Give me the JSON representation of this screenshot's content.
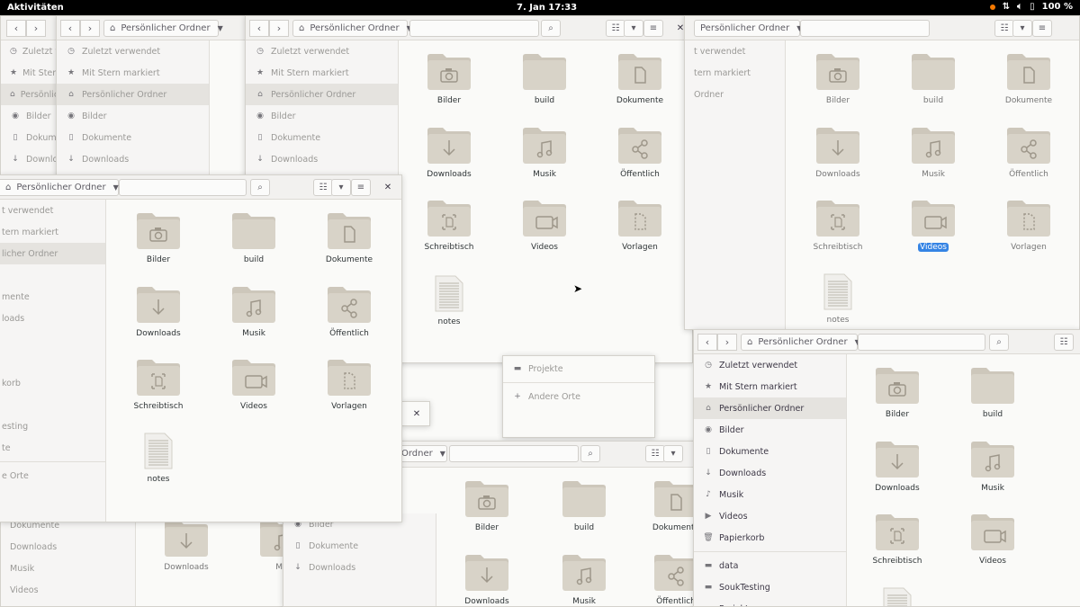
{
  "topbar": {
    "activities": "Aktivitäten",
    "clock": "7. Jan  17:33",
    "battery": "100 %"
  },
  "breadcrumb": "Persönlicher Ordner",
  "sidebar": {
    "recent": "Zuletzt verwendet",
    "starred": "Mit Stern markiert",
    "home": "Persönlicher Ordner",
    "pictures": "Bilder",
    "documents": "Dokumente",
    "downloads": "Downloads",
    "music": "Musik",
    "videos": "Videos",
    "trash": "Papierkorb",
    "data": "data",
    "souktesting": "SoukTesting",
    "projekte": "Projekte",
    "other": "Andere Orte"
  },
  "files": {
    "bilder": "Bilder",
    "build": "build",
    "dokumente": "Dokumente",
    "downloads": "Downloads",
    "musik": "Musik",
    "oeffentlich": "Öffentlich",
    "schreibtisch": "Schreibtisch",
    "videos": "Videos",
    "vorlagen": "Vorlagen",
    "notes": "notes"
  },
  "partial": {
    "dokume": "Dokume",
    "downloa": "Downloa",
    "ordner_tail": "licher Ordner",
    "verwendet_tail": "t verwendet",
    "markiert_tail": "tern markiert",
    "mente_tail": "mente",
    "loads_tail": "loads",
    "korb_tail": "korb",
    "testing_tail": "esting",
    "te_tail": "te",
    "orte_tail": "e Orte",
    "ordner_c": "Ordner",
    "mu": "Mu",
    "oeffentl": "Öffentli",
    "vo": "Vo",
    "n": "n",
    "notes_cut": "notes"
  },
  "icons": {
    "folder_color": "#d8d3c8",
    "folder_tab": "#cdc7bb",
    "symbol_color": "#9e978a",
    "accent": "#3584e4"
  }
}
